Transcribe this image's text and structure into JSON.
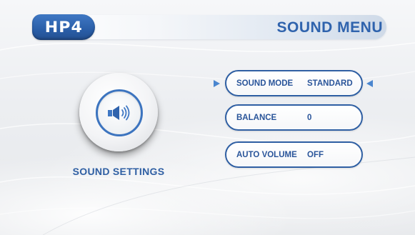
{
  "header": {
    "logo": "HP4",
    "title": "SOUND MENU"
  },
  "speaker": {
    "icon": "speaker-volume-icon",
    "label": "SOUND SETTINGS"
  },
  "menu": {
    "items": [
      {
        "label": "SOUND MODE",
        "value": "STANDARD",
        "selected": true
      },
      {
        "label": "BALANCE",
        "value": "0",
        "selected": false
      },
      {
        "label": "AUTO VOLUME",
        "value": "OFF",
        "selected": false
      }
    ]
  },
  "colors": {
    "accent": "#2f63ad",
    "logo_bg": "#2a5ea8",
    "arrow": "#4a86cf",
    "background": "#eceef1"
  }
}
